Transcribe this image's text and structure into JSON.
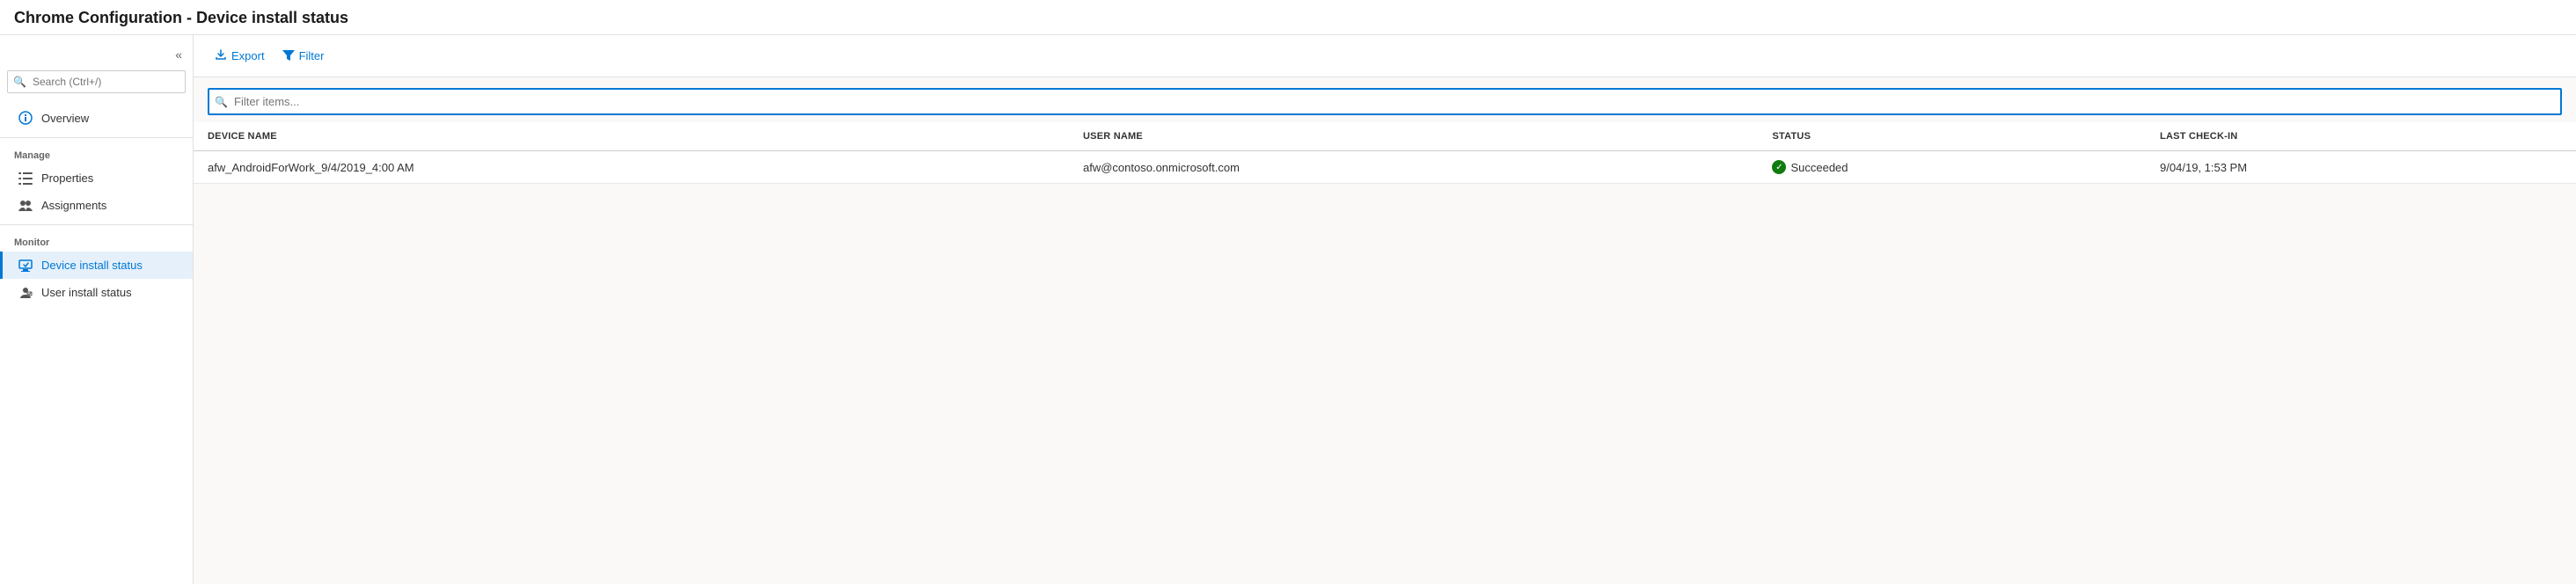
{
  "header": {
    "title": "Chrome Configuration - Device install status"
  },
  "sidebar": {
    "collapse_btn": "«",
    "search_placeholder": "Search (Ctrl+/)",
    "overview": {
      "label": "Overview",
      "icon": "ℹ"
    },
    "manage_section": "Manage",
    "manage_items": [
      {
        "id": "properties",
        "label": "Properties",
        "icon": "bars"
      },
      {
        "id": "assignments",
        "label": "Assignments",
        "icon": "people"
      }
    ],
    "monitor_section": "Monitor",
    "monitor_items": [
      {
        "id": "device-install-status",
        "label": "Device install status",
        "icon": "device",
        "active": true
      },
      {
        "id": "user-install-status",
        "label": "User install status",
        "icon": "user-device"
      }
    ]
  },
  "toolbar": {
    "export_label": "Export",
    "filter_label": "Filter"
  },
  "filter": {
    "placeholder": "Filter items..."
  },
  "table": {
    "columns": [
      {
        "id": "device_name",
        "label": "DEVICE NAME"
      },
      {
        "id": "user_name",
        "label": "USER NAME"
      },
      {
        "id": "status",
        "label": "STATUS"
      },
      {
        "id": "last_checkin",
        "label": "LAST CHECK-IN"
      }
    ],
    "rows": [
      {
        "device_name": "afw_AndroidForWork_9/4/2019_4:00 AM",
        "user_name": "afw@contoso.onmicrosoft.com",
        "status": "Succeeded",
        "status_type": "success",
        "last_checkin": "9/04/19, 1:53 PM"
      }
    ]
  }
}
